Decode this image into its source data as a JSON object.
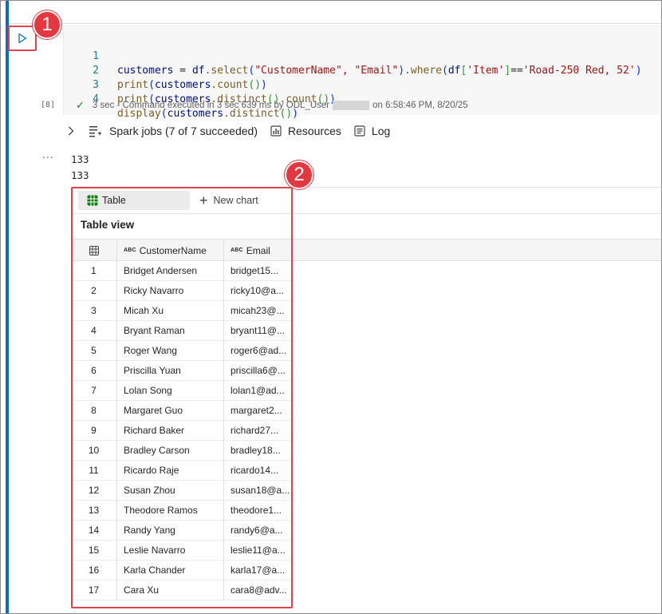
{
  "callouts": {
    "one": "1",
    "two": "2"
  },
  "cell": {
    "execution_count": "[8]",
    "code_lines": [
      {
        "num": "1"
      },
      {
        "num": "2"
      },
      {
        "num": "3"
      },
      {
        "num": "4"
      }
    ],
    "code_tokens": {
      "l1_var": "customers",
      "l1_eq": " = ",
      "l1_df": "df",
      "l1_select": ".select",
      "l1_args": "\"CustomerName\", \"Email\"",
      "l1_where": ".where",
      "l1_df2": "df",
      "l1_key": "'Item'",
      "l1_eqeq": "==",
      "l1_val": "'Road-250 Red, 52'",
      "l2_print": "print",
      "l2_var": "customers",
      "l2_count": ".count",
      "l3_print": "print",
      "l3_var": "customers",
      "l3_distinct": ".distinct",
      "l3_count": ".count",
      "l4_display": "display",
      "l4_var": "customers",
      "l4_distinct": ".distinct"
    },
    "status_prefix": "3 sec - Command executed in 3 sec 639 ms by ODL_User",
    "status_suffix": "on 6:58:46 PM, 8/20/25"
  },
  "spark": {
    "jobs_label": "Spark jobs (7 of 7 succeeded)",
    "resources_label": "Resources",
    "log_label": "Log"
  },
  "output": {
    "more": "...",
    "lines": [
      "133",
      "133"
    ]
  },
  "viewer": {
    "table_tab": "Table",
    "new_chart": "New chart",
    "title": "Table view",
    "type_badge": "ABC",
    "columns": [
      "CustomerName",
      "Email"
    ],
    "rows": [
      {
        "idx": "1",
        "name": "Bridget Andersen",
        "email": "bridget15..."
      },
      {
        "idx": "2",
        "name": "Ricky Navarro",
        "email": "ricky10@a..."
      },
      {
        "idx": "3",
        "name": "Micah Xu",
        "email": "micah23@..."
      },
      {
        "idx": "4",
        "name": "Bryant Raman",
        "email": "bryant11@..."
      },
      {
        "idx": "5",
        "name": "Roger Wang",
        "email": "roger6@ad..."
      },
      {
        "idx": "6",
        "name": "Priscilla Yuan",
        "email": "priscilla6@..."
      },
      {
        "idx": "7",
        "name": "Lolan Song",
        "email": "lolan1@ad..."
      },
      {
        "idx": "8",
        "name": "Margaret Guo",
        "email": "margaret2..."
      },
      {
        "idx": "9",
        "name": "Richard Baker",
        "email": "richard27..."
      },
      {
        "idx": "10",
        "name": "Bradley Carson",
        "email": "bradley18..."
      },
      {
        "idx": "11",
        "name": "Ricardo Raje",
        "email": "ricardo14..."
      },
      {
        "idx": "12",
        "name": "Susan Zhou",
        "email": "susan18@a..."
      },
      {
        "idx": "13",
        "name": "Theodore Ramos",
        "email": "theodore1..."
      },
      {
        "idx": "14",
        "name": "Randy Yang",
        "email": "randy6@a..."
      },
      {
        "idx": "15",
        "name": "Leslie Navarro",
        "email": "leslie11@a..."
      },
      {
        "idx": "16",
        "name": "Karla Chander",
        "email": "karla17@a..."
      },
      {
        "idx": "17",
        "name": "Cara Xu",
        "email": "cara8@adv..."
      }
    ]
  },
  "colors": {
    "accent": "#0f6cbd",
    "callout": "#e5373f",
    "success": "#107c10"
  }
}
